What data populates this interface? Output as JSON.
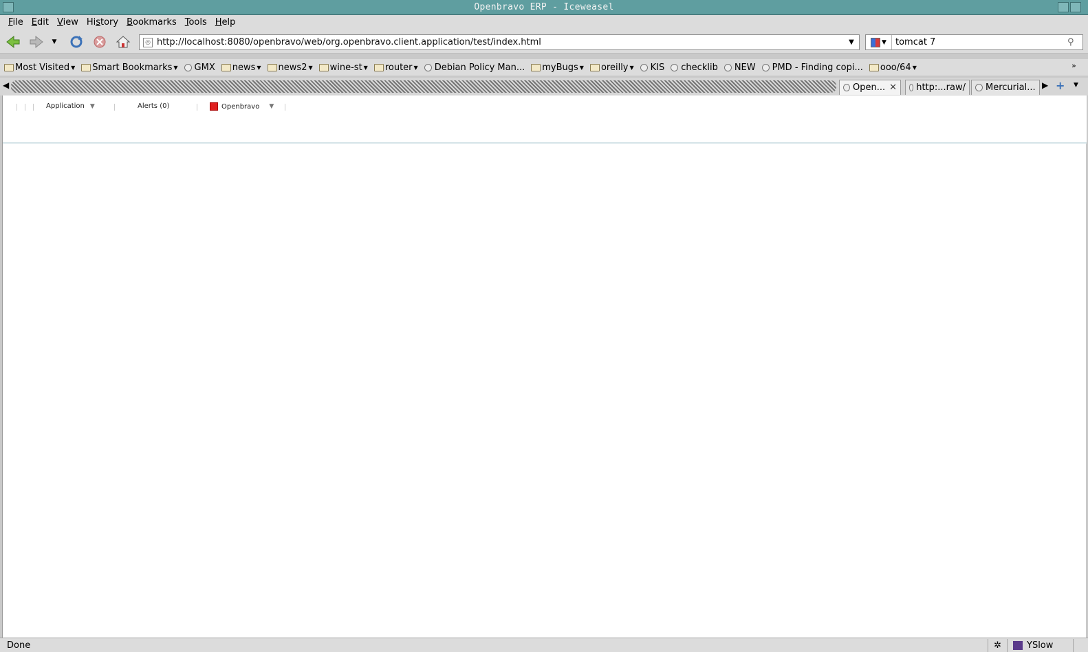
{
  "window": {
    "title": "Openbravo ERP - Iceweasel"
  },
  "menubar": {
    "items": [
      "File",
      "Edit",
      "View",
      "History",
      "Bookmarks",
      "Tools",
      "Help"
    ],
    "accelerators": [
      "F",
      "E",
      "V",
      "s",
      "B",
      "T",
      "H"
    ]
  },
  "navbar": {
    "url": "http://localhost:8080/openbravo/web/org.openbravo.client.application/test/index.html",
    "search_query": "tomcat 7"
  },
  "bookmarks": [
    {
      "label": "Most Visited",
      "type": "folder",
      "dropdown": true
    },
    {
      "label": "Smart Bookmarks",
      "type": "folder",
      "dropdown": true
    },
    {
      "label": "GMX",
      "type": "site",
      "dropdown": false
    },
    {
      "label": "news",
      "type": "folder",
      "dropdown": true
    },
    {
      "label": "news2",
      "type": "folder",
      "dropdown": true
    },
    {
      "label": "wine-st",
      "type": "folder",
      "dropdown": true
    },
    {
      "label": "router",
      "type": "folder",
      "dropdown": true
    },
    {
      "label": "Debian Policy Man...",
      "type": "site",
      "dropdown": false
    },
    {
      "label": "myBugs",
      "type": "folder",
      "dropdown": true
    },
    {
      "label": "oreilly",
      "type": "folder",
      "dropdown": true
    },
    {
      "label": "KIS",
      "type": "site",
      "dropdown": false
    },
    {
      "label": "checklib",
      "type": "site",
      "dropdown": false
    },
    {
      "label": "NEW",
      "type": "site",
      "dropdown": false
    },
    {
      "label": "PMD - Finding copi...",
      "type": "site",
      "dropdown": false
    },
    {
      "label": "ooo/64",
      "type": "folder",
      "dropdown": true
    }
  ],
  "tabs": [
    {
      "label": "Open...",
      "active": true
    },
    {
      "label": "http:...raw/",
      "active": false
    },
    {
      "label": "Mercurial...",
      "active": false
    }
  ],
  "openbravo_nav": {
    "application": "Application",
    "alerts": "Alerts (0)",
    "company": "Openbravo"
  },
  "statusbar": {
    "status": "Done",
    "yslow": "YSlow"
  },
  "colors": {
    "titlebar": "#5f9ea0",
    "chrome": "#dcdcdc"
  }
}
